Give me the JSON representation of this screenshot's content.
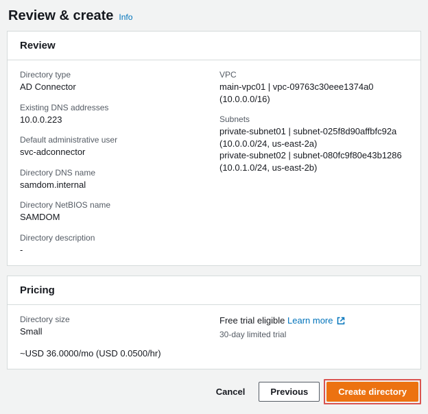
{
  "header": {
    "title": "Review & create",
    "info": "Info"
  },
  "reviewPanel": {
    "title": "Review",
    "left": {
      "directoryType": {
        "label": "Directory type",
        "value": "AD Connector"
      },
      "existingDns": {
        "label": "Existing DNS addresses",
        "value": "10.0.0.223"
      },
      "adminUser": {
        "label": "Default administrative user",
        "value": "svc-adconnector"
      },
      "dnsName": {
        "label": "Directory DNS name",
        "value": "samdom.internal"
      },
      "netbios": {
        "label": "Directory NetBIOS name",
        "value": "SAMDOM"
      },
      "description": {
        "label": "Directory description",
        "value": "-"
      }
    },
    "right": {
      "vpc": {
        "label": "VPC",
        "value": "main-vpc01 | vpc-09763c30eee1374a0 (10.0.0.0/16)"
      },
      "subnets": {
        "label": "Subnets",
        "value1": "private-subnet01 | subnet-025f8d90affbfc92a (10.0.0.0/24, us-east-2a)",
        "value2": "private-subnet02 | subnet-080fc9f80e43b1286 (10.0.1.0/24, us-east-2b)"
      }
    }
  },
  "pricingPanel": {
    "title": "Pricing",
    "left": {
      "size": {
        "label": "Directory size",
        "value": "Small"
      },
      "cost": "~USD 36.0000/mo (USD 0.0500/hr)"
    },
    "right": {
      "trialLabel": "Free trial eligible",
      "learnMore": "Learn more",
      "trialDesc": "30-day limited trial"
    }
  },
  "footer": {
    "cancel": "Cancel",
    "previous": "Previous",
    "create": "Create directory"
  }
}
